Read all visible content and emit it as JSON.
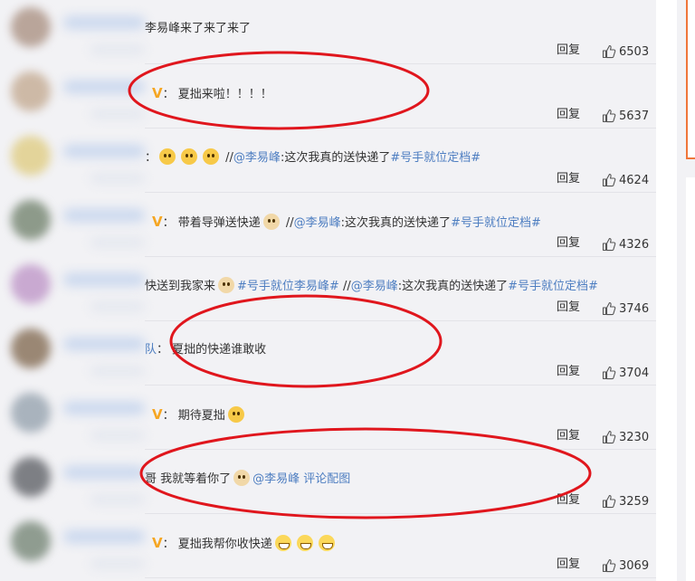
{
  "comments": [
    {
      "avatar_color": "#b9a59a",
      "badge": false,
      "parts": [
        {
          "text": "李易峰来了来了来了",
          "type": "text"
        }
      ],
      "reply_label": "回复",
      "likes": "6503"
    },
    {
      "avatar_color": "#cdb9a6",
      "badge": true,
      "parts": [
        {
          "text": "：  夏拙来啦！！！！",
          "type": "text"
        }
      ],
      "reply_label": "回复",
      "likes": "5637"
    },
    {
      "avatar_color": "#e3d49a",
      "badge": false,
      "parts": [
        {
          "text": "：",
          "type": "text"
        },
        {
          "type": "emoji",
          "emoji": "scared-face-emoji"
        },
        {
          "type": "emoji",
          "emoji": "scared-face-emoji"
        },
        {
          "type": "emoji",
          "emoji": "scared-face-emoji"
        },
        {
          "text": " //",
          "type": "text"
        },
        {
          "text": "@李易峰",
          "type": "link"
        },
        {
          "text": ":这次我真的送快递了",
          "type": "text"
        },
        {
          "text": "#号手就位定档#",
          "type": "link"
        }
      ],
      "reply_label": "回复",
      "likes": "4624"
    },
    {
      "avatar_color": "#8d9a8a",
      "badge": true,
      "parts": [
        {
          "text": "：  带着导弹送快递",
          "type": "text"
        },
        {
          "type": "emoji",
          "emoji": "dog-emoji"
        },
        {
          "text": " //",
          "type": "text"
        },
        {
          "text": "@李易峰",
          "type": "link"
        },
        {
          "text": ":这次我真的送快递了",
          "type": "text"
        },
        {
          "text": "#号手就位定档#",
          "type": "link"
        }
      ],
      "reply_label": "回复",
      "likes": "4326"
    },
    {
      "avatar_color": "#c9a9d1",
      "badge": false,
      "parts": [
        {
          "text": "快送到我家来",
          "type": "text"
        },
        {
          "type": "emoji",
          "emoji": "dog-emoji"
        },
        {
          "text": "#号手就位李易峰#",
          "type": "link"
        },
        {
          "text": " //",
          "type": "text"
        },
        {
          "text": "@李易峰",
          "type": "link"
        },
        {
          "text": ":这次我真的送快递了",
          "type": "text"
        },
        {
          "text": "#号手就位定档#",
          "type": "link"
        }
      ],
      "reply_label": "回复",
      "likes": "3746"
    },
    {
      "avatar_color": "#9a8774",
      "badge": false,
      "parts": [
        {
          "text": "队",
          "type": "link"
        },
        {
          "text": "：  夏拙的快递谁敢收",
          "type": "text"
        }
      ],
      "reply_label": "回复",
      "likes": "3704"
    },
    {
      "avatar_color": "#a9b3bd",
      "badge": true,
      "parts": [
        {
          "text": "：  期待夏拙",
          "type": "text"
        },
        {
          "type": "emoji",
          "emoji": "cheering-emoji"
        }
      ],
      "reply_label": "回复",
      "likes": "3230"
    },
    {
      "avatar_color": "#7d7f84",
      "badge": false,
      "parts": [
        {
          "text": "哥 我就等着你了",
          "type": "text"
        },
        {
          "type": "emoji",
          "emoji": "dog-emoji"
        },
        {
          "text": "@李易峰",
          "type": "link"
        },
        {
          "text": " 评论配图",
          "type": "link"
        }
      ],
      "reply_label": "回复",
      "likes": "3259"
    },
    {
      "avatar_color": "#8f9c90",
      "badge": true,
      "parts": [
        {
          "text": "：  夏拙我帮你收快递",
          "type": "text"
        },
        {
          "type": "emoji",
          "emoji": "grin-emoji"
        },
        {
          "type": "emoji",
          "emoji": "grin-emoji"
        },
        {
          "type": "emoji",
          "emoji": "grin-emoji"
        }
      ],
      "reply_label": "回复",
      "likes": "3069"
    }
  ],
  "colors": {
    "link": "#4e7ec1",
    "verified_badge": "#f5a623",
    "annotation_ellipse": "#e0161d",
    "feed_background": "#f2f2f5",
    "side_accent": "#f0763a"
  },
  "badge_glyph": "V"
}
